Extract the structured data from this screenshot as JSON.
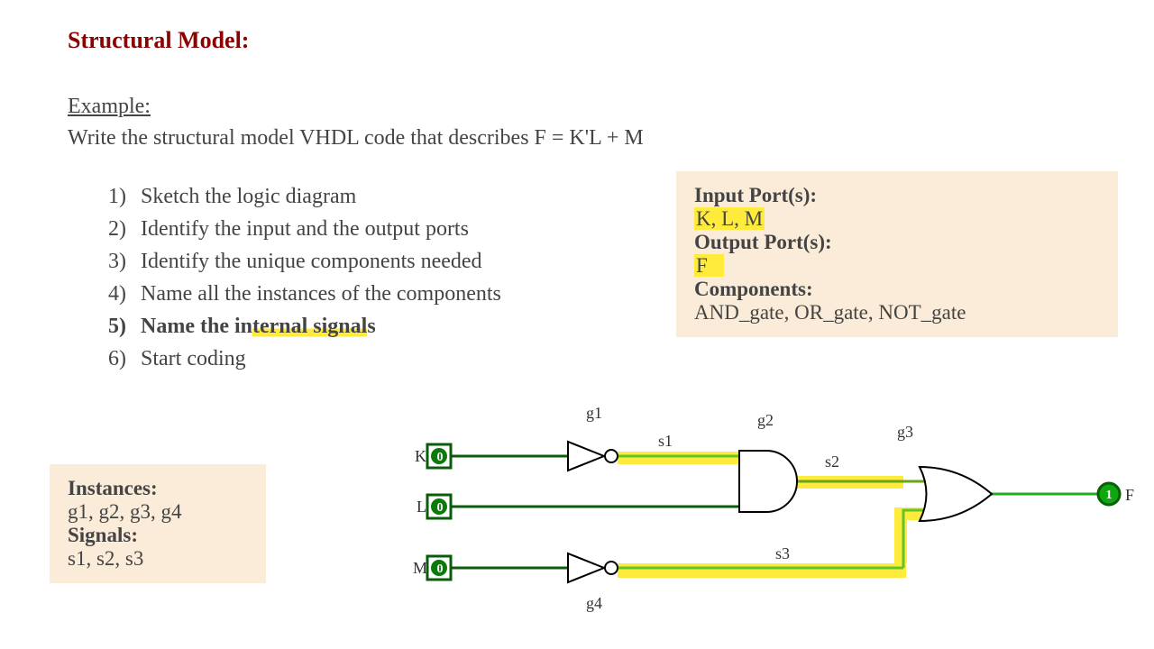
{
  "title": "Structural Model:",
  "example": "Example:",
  "prompt": "Write the structural model VHDL code that describes F = K'L + M",
  "steps": {
    "s1n": "1)",
    "s1": "Sketch the logic diagram",
    "s2n": "2)",
    "s2": "Identify the input and the output ports",
    "s3n": "3)",
    "s3": "Identify the unique components needed",
    "s4n": "4)",
    "s4": "Name all the instances of the components",
    "s5n": "5)",
    "s5a": "Name the in",
    "s5b": "ternal signal",
    "s5c": "s",
    "s6n": "6)",
    "s6": "Start coding"
  },
  "right": {
    "h1": "Input Port(s):",
    "v1": "K, L, M",
    "h2": "Output Port(s):",
    "v2": "F",
    "h3": "Components:",
    "v3": "AND_gate, OR_gate, NOT_gate"
  },
  "left": {
    "h1": "Instances:",
    "v1": "g1, g2, g3, g4",
    "h2": "Signals:",
    "v2": "s1, s2, s3"
  },
  "diag": {
    "K": "K",
    "L": "L",
    "M": "M",
    "F": "F",
    "z0": "0",
    "z1": "0",
    "z2": "0",
    "one": "1",
    "g1": "g1",
    "g2": "g2",
    "g3": "g3",
    "g4": "g4",
    "s1": "s1",
    "s2": "s2",
    "s3": "s3"
  }
}
